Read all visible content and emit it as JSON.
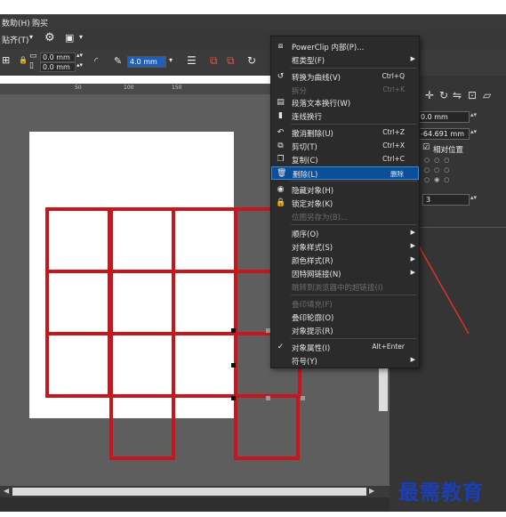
{
  "menubar": {
    "item1": "数助(H)",
    "item2": "购买"
  },
  "toolbar1": {
    "snap_label": "贴齐(T)"
  },
  "toolbar2": {
    "width_value": "0.0 mm",
    "height_value": "0.0 mm",
    "outline_width": "4.0 mm"
  },
  "ruler": {
    "ticks": [
      "50",
      "100",
      "150"
    ]
  },
  "right_panel": {
    "x_value": "0.0 mm",
    "y_value": "-64.691 mm",
    "relative_position_label": "相对位置",
    "count_value": "3"
  },
  "context_menu": {
    "items": [
      {
        "label": "PowerClip 内部(P)...",
        "shortcut": "",
        "submenu": false,
        "disabled": false,
        "icon": "powerclip-icon"
      },
      {
        "label": "框类型(F)",
        "shortcut": "",
        "submenu": true,
        "disabled": false,
        "icon": ""
      },
      {
        "label": "转换为曲线(V)",
        "shortcut": "Ctrl+Q",
        "submenu": false,
        "disabled": false,
        "icon": "convert-curve-icon"
      },
      {
        "label": "拆分",
        "shortcut": "Ctrl+K",
        "submenu": false,
        "disabled": true,
        "icon": ""
      },
      {
        "label": "段落文本换行(W)",
        "shortcut": "",
        "submenu": false,
        "disabled": false,
        "icon": "text-wrap-icon"
      },
      {
        "label": "连线换行",
        "shortcut": "",
        "submenu": false,
        "disabled": false,
        "icon": "line-wrap-icon"
      },
      {
        "label": "撤消删除(U)",
        "shortcut": "Ctrl+Z",
        "submenu": false,
        "disabled": false,
        "icon": "undo-icon"
      },
      {
        "label": "剪切(T)",
        "shortcut": "Ctrl+X",
        "submenu": false,
        "disabled": false,
        "icon": "cut-icon"
      },
      {
        "label": "复制(C)",
        "shortcut": "Ctrl+C",
        "submenu": false,
        "disabled": false,
        "icon": "copy-icon"
      },
      {
        "label": "删除(L)",
        "shortcut": "删除",
        "submenu": false,
        "disabled": false,
        "icon": "trash-icon",
        "selected": true
      },
      {
        "label": "隐藏对象(H)",
        "shortcut": "",
        "submenu": false,
        "disabled": false,
        "icon": "eye-icon"
      },
      {
        "label": "锁定对象(K)",
        "shortcut": "",
        "submenu": false,
        "disabled": false,
        "icon": "lock-icon"
      },
      {
        "label": "位图另存为(B)...",
        "shortcut": "",
        "submenu": false,
        "disabled": true,
        "icon": ""
      },
      {
        "label": "顺序(O)",
        "shortcut": "",
        "submenu": true,
        "disabled": false,
        "icon": ""
      },
      {
        "label": "对象样式(S)",
        "shortcut": "",
        "submenu": true,
        "disabled": false,
        "icon": ""
      },
      {
        "label": "颜色样式(R)",
        "shortcut": "",
        "submenu": true,
        "disabled": false,
        "icon": ""
      },
      {
        "label": "因特网链接(N)",
        "shortcut": "",
        "submenu": true,
        "disabled": false,
        "icon": ""
      },
      {
        "label": "跳转到浏览器中的超链接(I)",
        "shortcut": "",
        "submenu": false,
        "disabled": true,
        "icon": ""
      },
      {
        "label": "叠印填充(F)",
        "shortcut": "",
        "submenu": false,
        "disabled": true,
        "icon": ""
      },
      {
        "label": "叠印轮廓(O)",
        "shortcut": "",
        "submenu": false,
        "disabled": false,
        "icon": ""
      },
      {
        "label": "对象提示(R)",
        "shortcut": "",
        "submenu": false,
        "disabled": false,
        "icon": ""
      },
      {
        "label": "对象属性(I)",
        "shortcut": "Alt+Enter",
        "submenu": false,
        "disabled": false,
        "icon": "check-icon"
      },
      {
        "label": "符号(Y)",
        "shortcut": "",
        "submenu": true,
        "disabled": false,
        "icon": ""
      }
    ]
  },
  "watermark": "最需教育",
  "colors": {
    "shape_stroke": "#c8161d",
    "arrow": "#e0302c",
    "menu_highlight": "#0a4f97",
    "watermark": "#1b3fb3"
  }
}
